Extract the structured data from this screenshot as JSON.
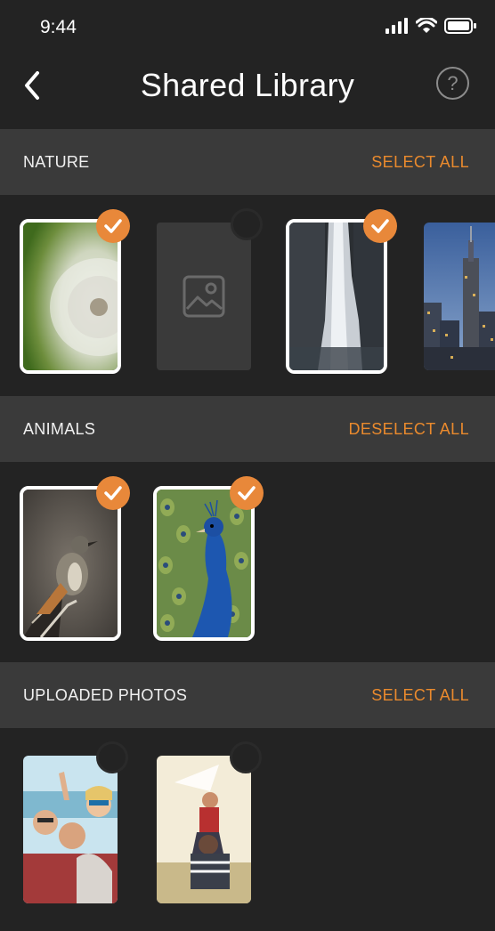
{
  "status_bar": {
    "time": "9:44"
  },
  "header": {
    "title": "Shared Library",
    "help_label": "?"
  },
  "sections": [
    {
      "title": "NATURE",
      "action": "SELECT ALL"
    },
    {
      "title": "ANIMALS",
      "action": "DESELECT ALL"
    },
    {
      "title": "UPLOADED PHOTOS",
      "action": "SELECT ALL"
    }
  ],
  "colors": {
    "accent": "#ea8a2d",
    "background": "#232323",
    "section_bg": "#3a3a3a"
  }
}
